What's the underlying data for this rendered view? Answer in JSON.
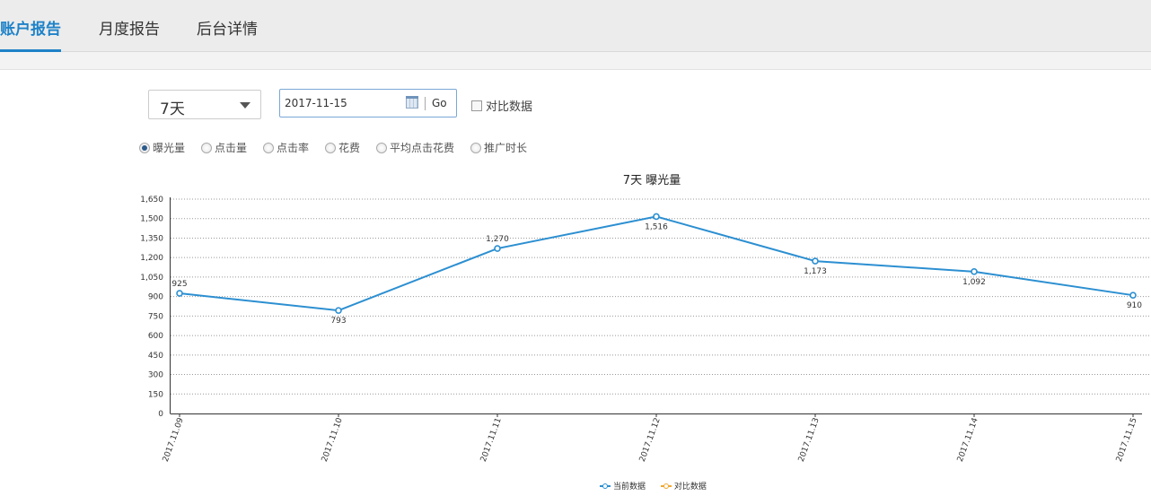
{
  "tabs": [
    {
      "label": "账户报告",
      "active": true
    },
    {
      "label": "月度报告",
      "active": false
    },
    {
      "label": "后台详情",
      "active": false
    }
  ],
  "filters": {
    "range_value": "7天",
    "date_value": "2017-11-15",
    "go_label": "Go",
    "compare_label": "对比数据",
    "compare_checked": false
  },
  "metrics": [
    {
      "label": "曝光量",
      "selected": true
    },
    {
      "label": "点击量",
      "selected": false
    },
    {
      "label": "点击率",
      "selected": false
    },
    {
      "label": "花费",
      "selected": false
    },
    {
      "label": "平均点击花费",
      "selected": false
    },
    {
      "label": "推广时长",
      "selected": false
    }
  ],
  "colors": {
    "accent": "#1e82c8",
    "series_current": "#2c8fd1",
    "series_compare": "#f0a830"
  },
  "chart_data": {
    "type": "line",
    "title": "7天  曝光量",
    "categories": [
      "2017.11.09",
      "2017.11.10",
      "2017.11.11",
      "2017.11.12",
      "2017.11.13",
      "2017.11.14",
      "2017.11.15"
    ],
    "y_ticks": [
      "0",
      "150",
      "300",
      "450",
      "600",
      "750",
      "900",
      "1,050",
      "1,200",
      "1,350",
      "1,500",
      "1,650"
    ],
    "ylim": [
      0,
      1650
    ],
    "grid": true,
    "series": [
      {
        "name": "当前数据",
        "values": [
          925,
          793,
          1270,
          1516,
          1173,
          1092,
          910
        ],
        "labels": [
          "925",
          "793",
          "1,270",
          "1,516",
          "1,173",
          "1,092",
          "910"
        ]
      },
      {
        "name": "对比数据",
        "values": []
      }
    ],
    "legend": "bottom-center"
  }
}
